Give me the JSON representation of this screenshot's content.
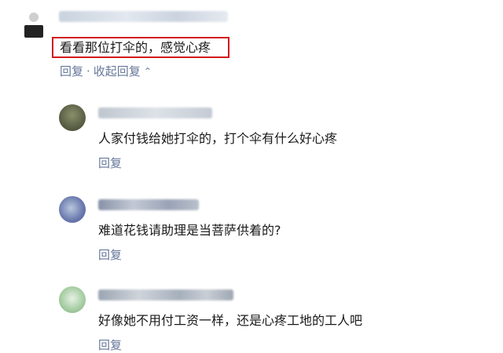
{
  "parent_comment": {
    "text": "看看那位打伞的，感觉心疼",
    "reply_label": "回复",
    "separator": "·",
    "collapse_label": "收起回复",
    "collapse_icon": "chevron-up-icon"
  },
  "replies": [
    {
      "text": "人家付钱给她打伞的，打个伞有什么好心疼",
      "reply_label": "回复"
    },
    {
      "text": "难道花钱请助理是当菩萨供着的?",
      "reply_label": "回复"
    },
    {
      "text": "好像她不用付工资一样，还是心疼工地的工人吧",
      "reply_label": "回复"
    }
  ],
  "colors": {
    "action_link": "#66779a",
    "highlight_border": "#d11a1a"
  }
}
